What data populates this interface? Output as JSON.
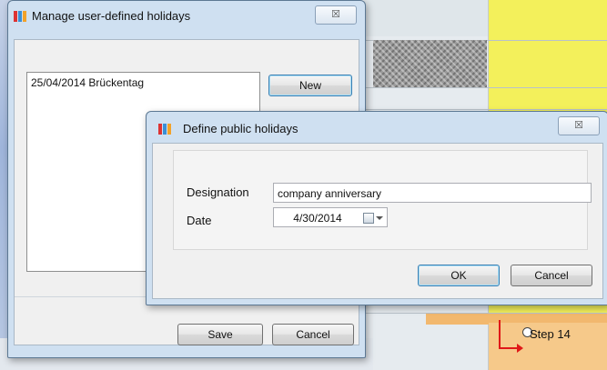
{
  "manage_dialog": {
    "title": "Manage user-defined holidays",
    "close_symbol": "☒",
    "holidays": [
      {
        "text": "25/04/2014 Brückentag"
      }
    ],
    "new_label": "New",
    "save_label": "Save",
    "cancel_label": "Cancel"
  },
  "define_dialog": {
    "title": "Define public holidays",
    "close_symbol": "☒",
    "designation_label": "Designation",
    "designation_value": "company anniversary",
    "date_label": "Date",
    "date_value": "4/30/2014",
    "ok_label": "OK",
    "cancel_label": "Cancel"
  },
  "gantt": {
    "step_label": "Step 14",
    "colors": {
      "highlight_column": "#f3f05b",
      "bar_orange": "#f2b86e",
      "arrow": "#e01818"
    }
  },
  "icons": {
    "app": "app-icon",
    "close": "close-icon",
    "calendar": "calendar-icon",
    "dropdown": "chevron-down-icon",
    "dependency": "dependency-arrow-icon"
  }
}
